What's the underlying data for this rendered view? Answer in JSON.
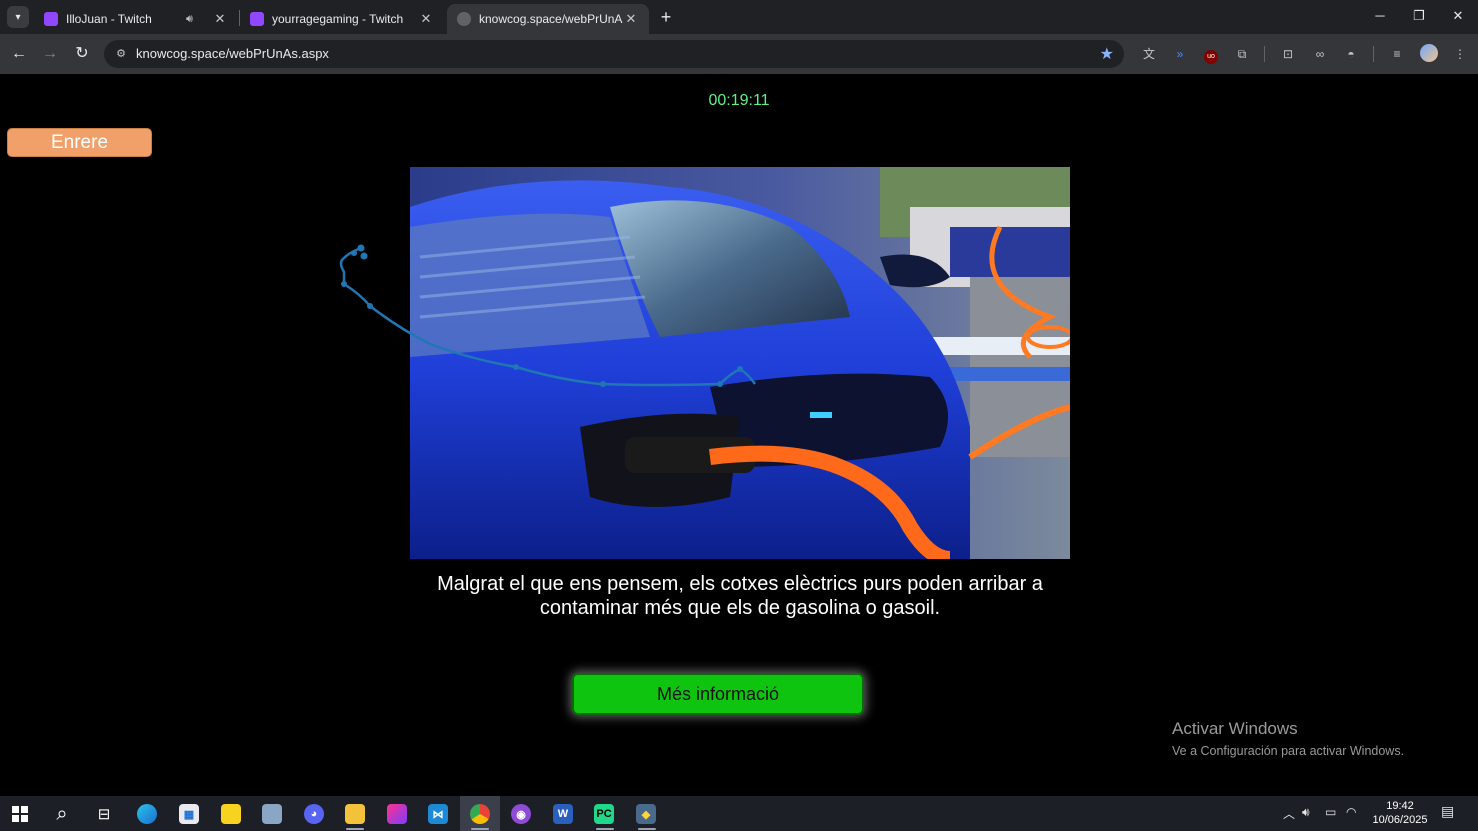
{
  "browser": {
    "tabs": [
      {
        "title": "IlloJuan - Twitch",
        "favicon": "twitch-icon"
      },
      {
        "title": "yourragegaming - Twitch",
        "favicon": "twitch-icon"
      },
      {
        "title": "knowcog.space/webPrUnAs.aspx",
        "favicon": "globe-icon"
      }
    ],
    "url": "knowcog.space/webPrUnAs.aspx"
  },
  "page": {
    "timer": "00:19:11",
    "back_label": "Enrere",
    "statement": "Malgrat el que ens pensem, els cotxes elèctrics purs poden arribar a contaminar més que els de gasolina o gasoil.",
    "more_label": "Més informació",
    "image_alt": "Cotxe elèctric blau carregant-se amb un cable taronja",
    "colors": {
      "timer": "#5ef08a",
      "back_button": "#f2a06a",
      "more_button": "#0fc40f"
    }
  },
  "watermark": {
    "title": "Activar Windows",
    "subtitle": "Ve a Configuración para activar Windows."
  },
  "taskbar": {
    "time": "19:42",
    "date": "10/06/2025"
  }
}
